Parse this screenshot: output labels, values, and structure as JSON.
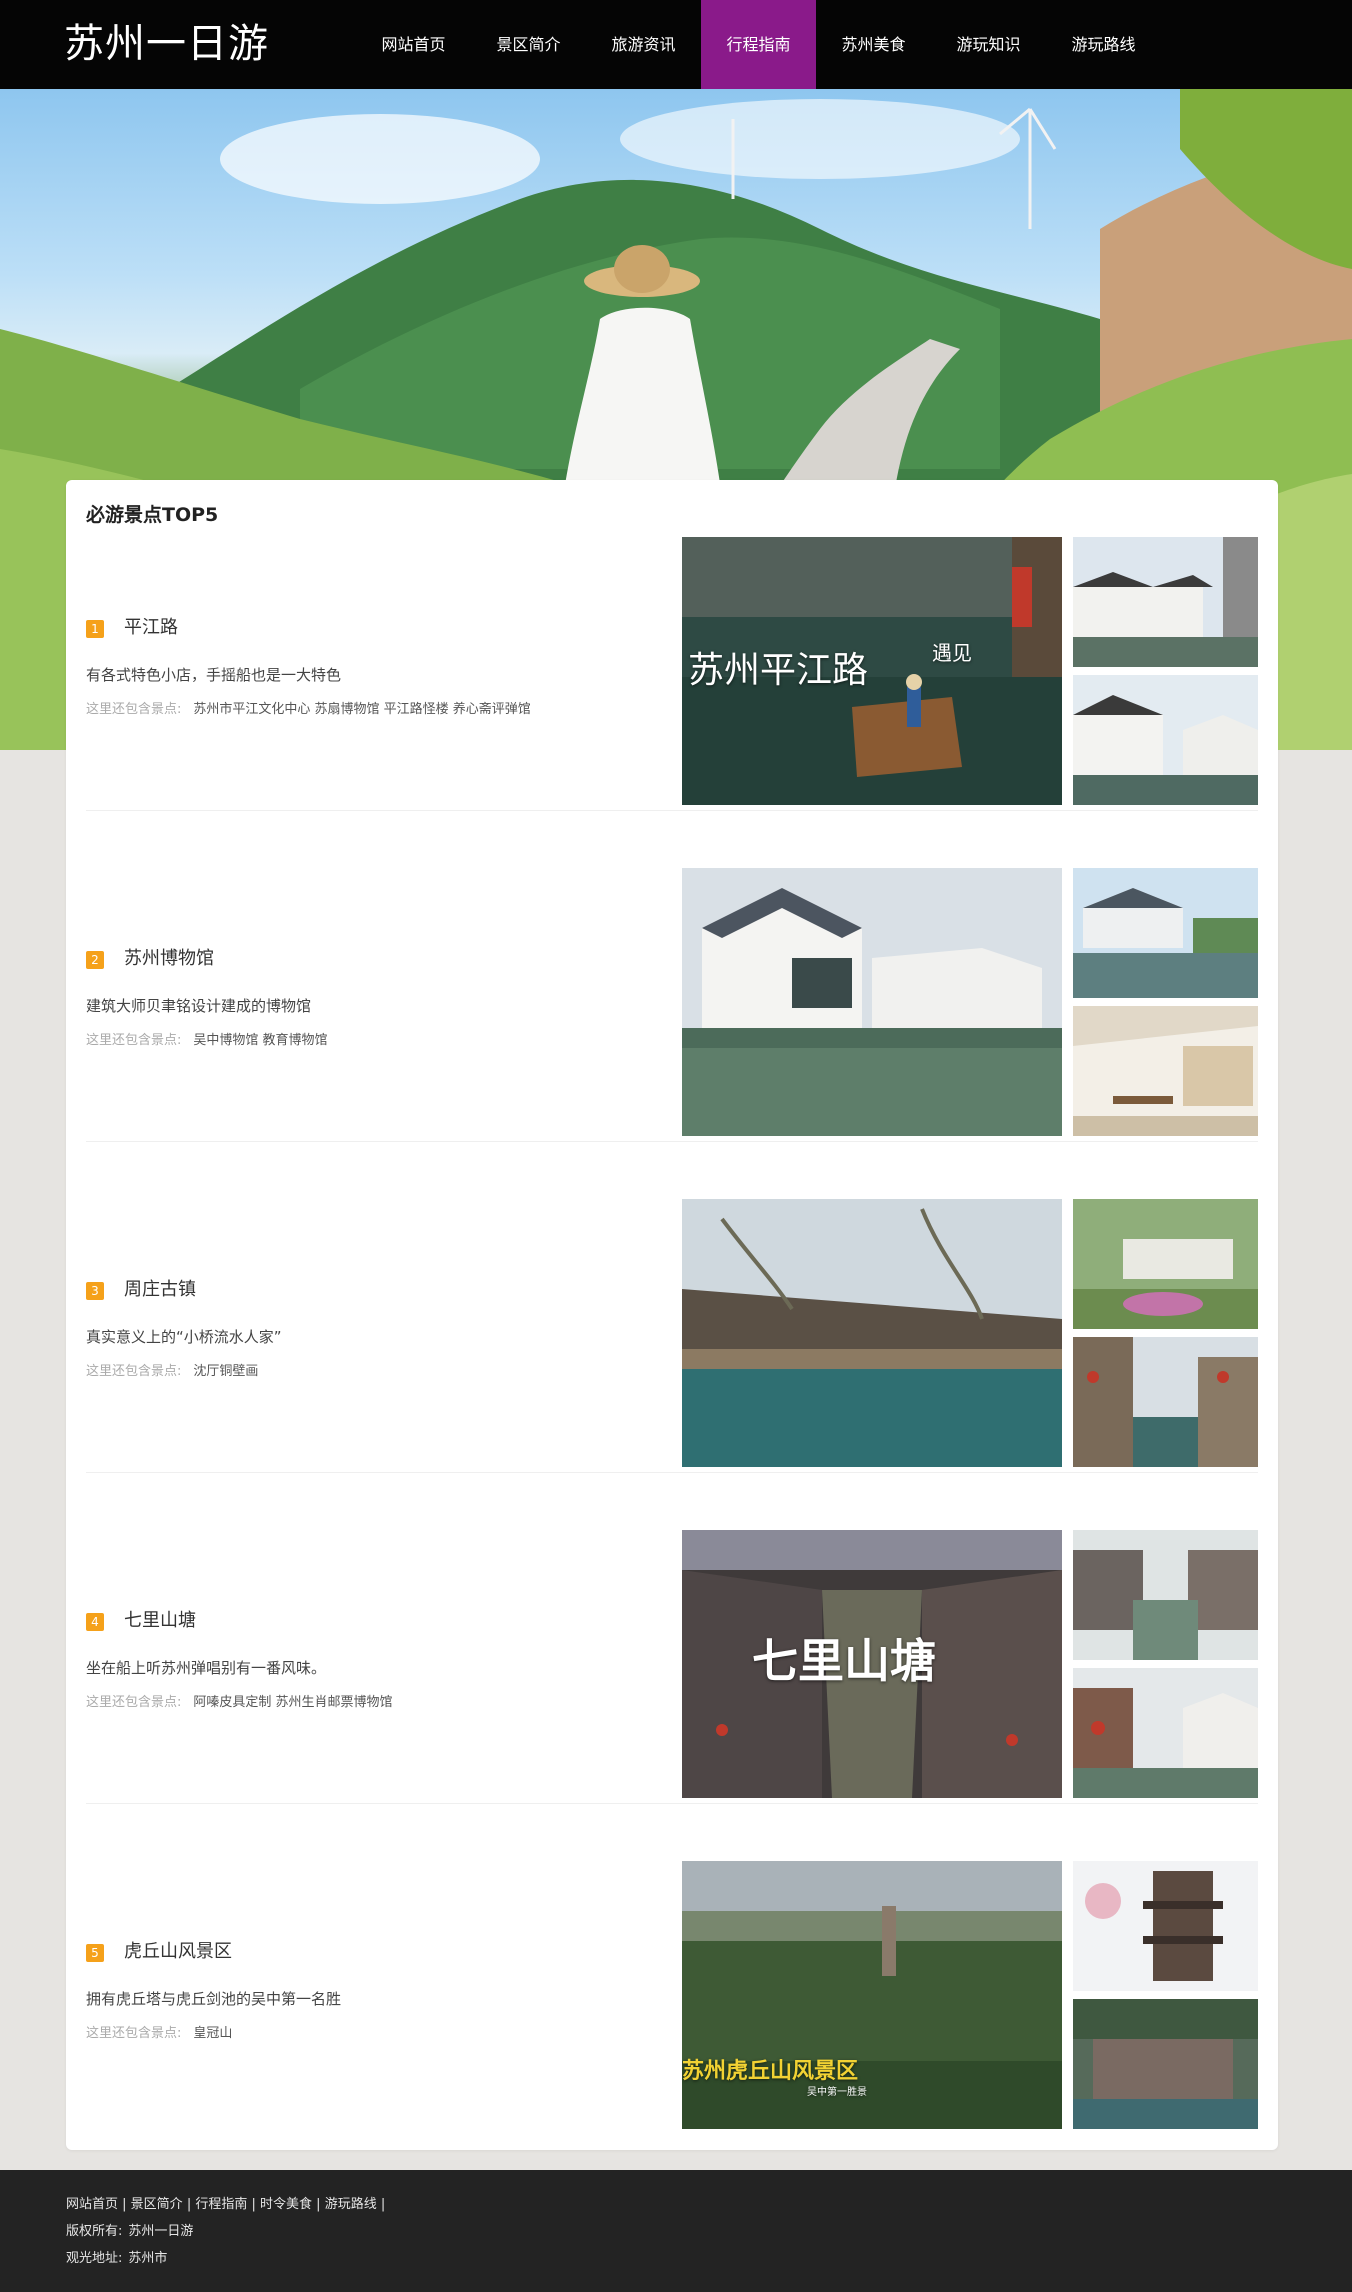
{
  "site": {
    "logo": "苏州一日游"
  },
  "nav": {
    "items": [
      {
        "label": "网站首页"
      },
      {
        "label": "景区简介"
      },
      {
        "label": "旅游资讯"
      },
      {
        "label": "行程指南"
      },
      {
        "label": "苏州美食"
      },
      {
        "label": "游玩知识"
      },
      {
        "label": "游玩路线"
      }
    ],
    "active_index": 3
  },
  "section": {
    "title": "必游景点TOP5",
    "extra_label": "这里还包含景点:",
    "items": [
      {
        "rank": "1",
        "name": "平江路",
        "desc": "有各式特色小店，手摇船也是一大特色",
        "extra": "苏州市平江文化中心 苏扇博物馆 平江路怪楼 养心斋评弹馆",
        "overlay": "苏州平江路",
        "overlay2": "遇见"
      },
      {
        "rank": "2",
        "name": "苏州博物馆",
        "desc": "建筑大师贝聿铭设计建成的博物馆",
        "extra": "吴中博物馆 教育博物馆",
        "overlay": "",
        "overlay2": ""
      },
      {
        "rank": "3",
        "name": "周庄古镇",
        "desc": "真实意义上的“小桥流水人家”",
        "extra": "沈厅铜壁画",
        "overlay": "",
        "overlay2": ""
      },
      {
        "rank": "4",
        "name": "七里山塘",
        "desc": "坐在船上听苏州弹唱别有一番风味。",
        "extra": "阿嗪皮具定制 苏州生肖邮票博物馆",
        "overlay": "七里山塘",
        "overlay2": ""
      },
      {
        "rank": "5",
        "name": "虎丘山风景区",
        "desc": "拥有虎丘塔与虎丘剑池的吴中第一名胜",
        "extra": "皇冠山",
        "overlay": "苏州虎丘山风景区",
        "overlay2": "吴中第一胜景"
      }
    ]
  },
  "footer": {
    "links": [
      "网站首页",
      "景区简介",
      "行程指南",
      "时令美食",
      "游玩路线"
    ],
    "copyright_label": "版权所有:",
    "copyright_value": "苏州一日游",
    "address_label": "观光地址:",
    "address_value": "苏州市"
  },
  "colors": {
    "header_bg": "#050505",
    "nav_active": "#8a1a8a",
    "rank_badge": "#f5a11a",
    "footer_bg": "#232323"
  }
}
